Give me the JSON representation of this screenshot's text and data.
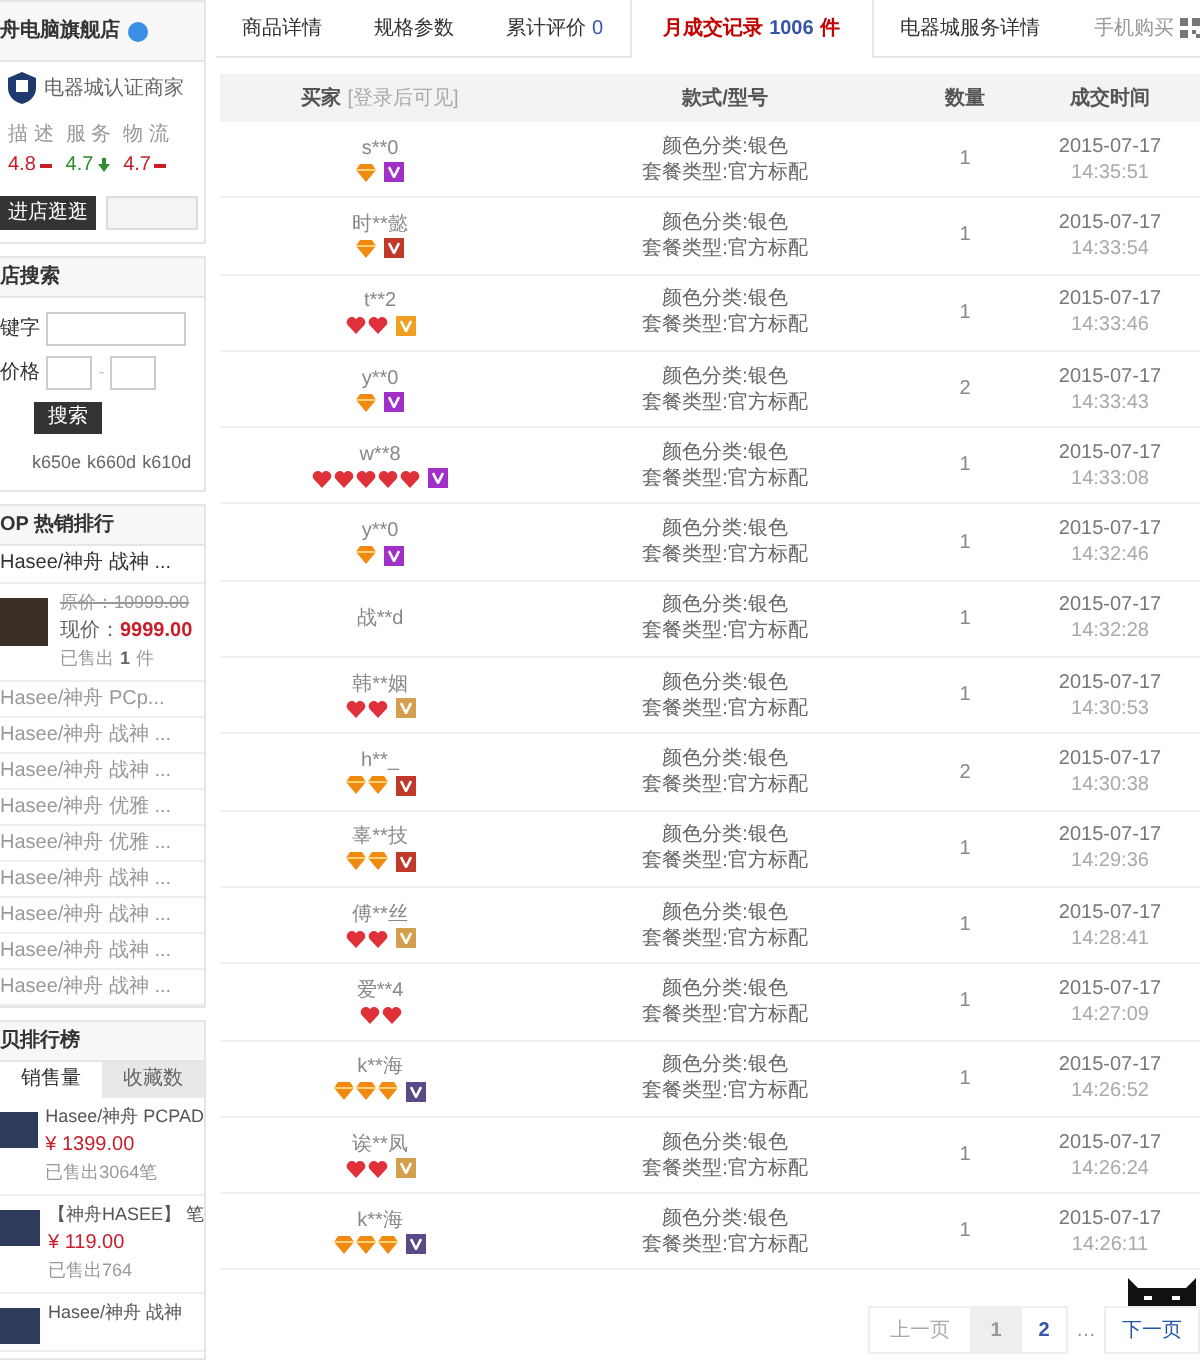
{
  "shop": {
    "name": "舟电脑旗舰店",
    "certification": "电器城认证商家",
    "ratings": [
      {
        "label": "描 述",
        "value": "4.8",
        "kind": "flat"
      },
      {
        "label": "服 务",
        "value": "4.7",
        "kind": "down"
      },
      {
        "label": "物 流",
        "value": "4.7",
        "kind": "flat"
      }
    ],
    "enter_button": "进店逛逛"
  },
  "shop_search": {
    "title": "店搜索",
    "keyword_label": "键字",
    "price_label": "价格",
    "price_separator": "-",
    "button": "搜索",
    "tags": [
      "k650e",
      "k660d",
      "k610d"
    ]
  },
  "top_sales": {
    "title": "OP 热销排行",
    "items": [
      {
        "kind": "featured",
        "title": "Hasee/神舟 战神 ...",
        "original_price": "原价：10999.00",
        "price_label": "现价：",
        "price": "9999.00",
        "sold_label": "已售出",
        "sold": "1",
        "sold_unit": "件"
      },
      {
        "kind": "plain",
        "title": "Hasee/神舟 PCp..."
      },
      {
        "kind": "plain",
        "title": "Hasee/神舟 战神 ..."
      },
      {
        "kind": "plain",
        "title": "Hasee/神舟 战神 ..."
      },
      {
        "kind": "plain",
        "title": "Hasee/神舟 优雅 ..."
      },
      {
        "kind": "plain",
        "title": "Hasee/神舟 优雅 ..."
      },
      {
        "kind": "plain",
        "title": "Hasee/神舟 战神 ..."
      },
      {
        "kind": "plain",
        "title": "Hasee/神舟 战神 ..."
      },
      {
        "kind": "plain",
        "title": "Hasee/神舟 战神 ..."
      },
      {
        "kind": "plain",
        "title": "Hasee/神舟 战神 ..."
      }
    ]
  },
  "ranking": {
    "title": "贝排行榜",
    "tabs": [
      {
        "label": "销售量",
        "selected": true
      },
      {
        "label": "收藏数",
        "selected": false
      }
    ],
    "items": [
      {
        "title": "Hasee/神舟 PCPAD",
        "price": "¥ 1399.00",
        "sold": "已售出3064笔"
      },
      {
        "title": "【神舟HASEE】 笔",
        "price": "¥ 119.00",
        "sold": "已售出764"
      },
      {
        "title": "Hasee/神舟 战神"
      }
    ]
  },
  "tabs": [
    {
      "label": "商品详情",
      "selected": false
    },
    {
      "label": "规格参数",
      "selected": false
    },
    {
      "label": "累计评价",
      "count": "0",
      "selected": false
    },
    {
      "label": "月成交记录",
      "count": "1006",
      "unit": "件",
      "selected": true
    },
    {
      "label": "电器城服务详情",
      "selected": false
    }
  ],
  "mobile_buy": "手机购买",
  "table": {
    "columns": [
      {
        "label": "买家",
        "hint": "[登录后可见]"
      },
      {
        "label": "款式/型号"
      },
      {
        "label": "数量"
      },
      {
        "label": "成交时间"
      }
    ],
    "rows": [
      {
        "buyer": "s**0",
        "rank_icons": [
          {
            "kind": "diamond"
          }
        ],
        "color": "#a030c8",
        "style": [
          "颜色分类:银色",
          "套餐类型:官方标配"
        ],
        "quantity": "1",
        "date": "2015-07-17",
        "time": "14:35:51"
      },
      {
        "buyer": "时**懿",
        "rank_icons": [
          {
            "kind": "diamond"
          }
        ],
        "color": "#c0392b",
        "style": [
          "颜色分类:银色",
          "套餐类型:官方标配"
        ],
        "quantity": "1",
        "date": "2015-07-17",
        "time": "14:33:54"
      },
      {
        "buyer": "t**2",
        "rank_icons": [
          {
            "kind": "heart"
          },
          {
            "kind": "heart"
          }
        ],
        "color": "#f0a020",
        "style": [
          "颜色分类:银色",
          "套餐类型:官方标配"
        ],
        "quantity": "1",
        "date": "2015-07-17",
        "time": "14:33:46"
      },
      {
        "buyer": "y**0",
        "rank_icons": [
          {
            "kind": "diamond"
          }
        ],
        "color": "#a030c8",
        "style": [
          "颜色分类:银色",
          "套餐类型:官方标配"
        ],
        "quantity": "2",
        "date": "2015-07-17",
        "time": "14:33:43"
      },
      {
        "buyer": "w**8",
        "rank_icons": [
          {
            "kind": "heart"
          },
          {
            "kind": "heart"
          },
          {
            "kind": "heart"
          },
          {
            "kind": "heart"
          },
          {
            "kind": "heart"
          }
        ],
        "color": "#a030c8",
        "style": [
          "颜色分类:银色",
          "套餐类型:官方标配"
        ],
        "quantity": "1",
        "date": "2015-07-17",
        "time": "14:33:08"
      },
      {
        "buyer": "y**0",
        "rank_icons": [
          {
            "kind": "diamond"
          }
        ],
        "color": "#a030c8",
        "style": [
          "颜色分类:银色",
          "套餐类型:官方标配"
        ],
        "quantity": "1",
        "date": "2015-07-17",
        "time": "14:32:46"
      },
      {
        "buyer": "战**d",
        "style": [
          "颜色分类:银色",
          "套餐类型:官方标配"
        ],
        "quantity": "1",
        "date": "2015-07-17",
        "time": "14:32:28"
      },
      {
        "buyer": "韩**姻",
        "rank_icons": [
          {
            "kind": "heart"
          },
          {
            "kind": "heart"
          }
        ],
        "color": "#d4a050",
        "style": [
          "颜色分类:银色",
          "套餐类型:官方标配"
        ],
        "quantity": "1",
        "date": "2015-07-17",
        "time": "14:30:53"
      },
      {
        "buyer": "h**_",
        "rank_icons": [
          {
            "kind": "diamond"
          },
          {
            "kind": "diamond"
          }
        ],
        "color": "#c0392b",
        "style": [
          "颜色分类:银色",
          "套餐类型:官方标配"
        ],
        "quantity": "2",
        "date": "2015-07-17",
        "time": "14:30:38"
      },
      {
        "buyer": "辜**技",
        "rank_icons": [
          {
            "kind": "diamond"
          },
          {
            "kind": "diamond"
          }
        ],
        "color": "#c0392b",
        "style": [
          "颜色分类:银色",
          "套餐类型:官方标配"
        ],
        "quantity": "1",
        "date": "2015-07-17",
        "time": "14:29:36"
      },
      {
        "buyer": "傅**丝",
        "rank_icons": [
          {
            "kind": "heart"
          },
          {
            "kind": "heart"
          }
        ],
        "color": "#d4a050",
        "style": [
          "颜色分类:银色",
          "套餐类型:官方标配"
        ],
        "quantity": "1",
        "date": "2015-07-17",
        "time": "14:28:41"
      },
      {
        "buyer": "爱**4",
        "rank_icons": [
          {
            "kind": "heart"
          },
          {
            "kind": "heart"
          }
        ],
        "style": [
          "颜色分类:银色",
          "套餐类型:官方标配"
        ],
        "quantity": "1",
        "date": "2015-07-17",
        "time": "14:27:09"
      },
      {
        "buyer": "k**海",
        "rank_icons": [
          {
            "kind": "diamond"
          },
          {
            "kind": "diamond"
          },
          {
            "kind": "diamond"
          }
        ],
        "color": "#5a4a8a",
        "style": [
          "颜色分类:银色",
          "套餐类型:官方标配"
        ],
        "quantity": "1",
        "date": "2015-07-17",
        "time": "14:26:52"
      },
      {
        "buyer": "诶**凤",
        "rank_icons": [
          {
            "kind": "heart"
          },
          {
            "kind": "heart"
          }
        ],
        "color": "#d4a050",
        "style": [
          "颜色分类:银色",
          "套餐类型:官方标配"
        ],
        "quantity": "1",
        "date": "2015-07-17",
        "time": "14:26:24"
      },
      {
        "buyer": "k**海",
        "rank_icons": [
          {
            "kind": "diamond"
          },
          {
            "kind": "diamond"
          },
          {
            "kind": "diamond"
          }
        ],
        "color": "#5a4a8a",
        "style": [
          "颜色分类:银色",
          "套餐类型:官方标配"
        ],
        "quantity": "1",
        "date": "2015-07-17",
        "time": "14:26:11"
      }
    ]
  },
  "pagination": {
    "prev": "上一页",
    "pages": [
      {
        "label": "1",
        "selected": true
      },
      {
        "label": "2",
        "selected": false
      }
    ],
    "ellipsis": "…",
    "next": "下一页"
  }
}
